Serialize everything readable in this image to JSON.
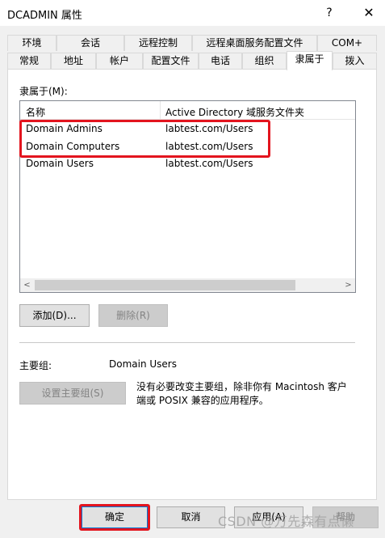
{
  "window": {
    "title": "DCADMIN 属性",
    "help_glyph": "?",
    "close_glyph": "✕"
  },
  "tabs": {
    "row1": [
      "环境",
      "会话",
      "远程控制",
      "远程桌面服务配置文件",
      "COM+"
    ],
    "row2": [
      "常规",
      "地址",
      "帐户",
      "配置文件",
      "电话",
      "组织",
      "隶属于",
      "拨入"
    ],
    "active": "隶属于"
  },
  "member_of": {
    "label": "隶属于(M):",
    "columns": [
      "名称",
      "Active Directory 域服务文件夹"
    ],
    "rows": [
      {
        "name": "Domain Admins",
        "folder": "labtest.com/Users"
      },
      {
        "name": "Domain Computers",
        "folder": "labtest.com/Users"
      },
      {
        "name": "Domain Users",
        "folder": "labtest.com/Users"
      }
    ],
    "scroll_left_glyph": "<",
    "scroll_right_glyph": ">"
  },
  "buttons": {
    "add": "添加(D)...",
    "remove": "删除(R)",
    "set_primary": "设置主要组(S)",
    "ok": "确定",
    "cancel": "取消",
    "apply": "应用(A)",
    "help": "帮助"
  },
  "primary_group": {
    "label": "主要组:",
    "value": "Domain Users",
    "description": "没有必要改变主要组，除非你有 Macintosh 客户端或 POSIX 兼容的应用程序。"
  },
  "watermark": "CSDN @万先森有点懒",
  "colors": {
    "highlight_border": "#e3141e",
    "focus_border": "#0078d7"
  }
}
